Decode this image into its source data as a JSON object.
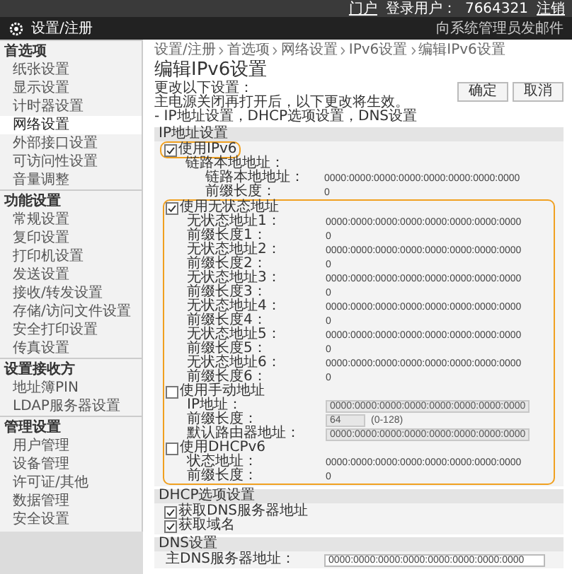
{
  "top_bar": {
    "portal": "门户",
    "login_label": "登录用户：",
    "user": "7664321",
    "logout": "注销"
  },
  "header": {
    "title": "设置/注册",
    "mail_link": "向系统管理员发邮件"
  },
  "sidebar": {
    "groups": [
      {
        "title": "首选项",
        "items": [
          {
            "label": "纸张设置",
            "selected": false
          },
          {
            "label": "显示设置",
            "selected": false
          },
          {
            "label": "计时器设置",
            "selected": false
          },
          {
            "label": "网络设置",
            "selected": true
          },
          {
            "label": "外部接口设置",
            "selected": false
          },
          {
            "label": "可访问性设置",
            "selected": false
          },
          {
            "label": "音量调整",
            "selected": false
          }
        ]
      },
      {
        "title": "功能设置",
        "items": [
          {
            "label": "常规设置",
            "selected": false
          },
          {
            "label": "复印设置",
            "selected": false
          },
          {
            "label": "打印机设置",
            "selected": false
          },
          {
            "label": "发送设置",
            "selected": false
          },
          {
            "label": "接收/转发设置",
            "selected": false
          },
          {
            "label": "存储/访问文件设置",
            "selected": false
          },
          {
            "label": "安全打印设置",
            "selected": false
          },
          {
            "label": "传真设置",
            "selected": false
          }
        ]
      },
      {
        "title": "设置接收方",
        "items": [
          {
            "label": "地址簿PIN",
            "selected": false
          },
          {
            "label": "LDAP服务器设置",
            "selected": false
          }
        ]
      },
      {
        "title": "管理设置",
        "items": [
          {
            "label": "用户管理",
            "selected": false
          },
          {
            "label": "设备管理",
            "selected": false
          },
          {
            "label": "许可证/其他",
            "selected": false
          },
          {
            "label": "数据管理",
            "selected": false
          },
          {
            "label": "安全设置",
            "selected": false
          }
        ]
      }
    ]
  },
  "breadcrumb": [
    "设置/注册",
    "首选项",
    "网络设置",
    "IPv6设置",
    "编辑IPv6设置"
  ],
  "title": "编辑IPv6设置",
  "notes": [
    "更改以下设置：",
    "主电源关闭再打开后，以下更改将生效。",
    "- IP地址设置，DHCP选项设置，DNS设置"
  ],
  "buttons": [
    "确定",
    "取消"
  ],
  "sections": [
    {
      "title": "IP地址设置",
      "items": [
        {
          "kind": "checkbox",
          "label": "使用IPv6",
          "checked": true,
          "highlighted": true,
          "children": [
            {
              "kind": "label",
              "label": "链路本地地址：",
              "children": [
                {
                  "kind": "value",
                  "label": "链路本地地址：",
                  "value": "0000:0000:0000:0000:0000:0000:0000:0000"
                },
                {
                  "kind": "value",
                  "label": "前缀长度：",
                  "value": "0"
                }
              ]
            }
          ]
        },
        {
          "kind": "frame",
          "children": [
            {
              "kind": "checkbox",
              "label": "使用无状态地址",
              "checked": true,
              "highlighted": false,
              "children": [
                {
                  "kind": "value",
                  "label": "无状态地址1：",
                  "value": "0000:0000:0000:0000:0000:0000:0000:0000"
                },
                {
                  "kind": "value",
                  "label": "前缀长度1：",
                  "value": "0"
                },
                {
                  "kind": "value",
                  "label": "无状态地址2：",
                  "value": "0000:0000:0000:0000:0000:0000:0000:0000"
                },
                {
                  "kind": "value",
                  "label": "前缀长度2：",
                  "value": "0"
                },
                {
                  "kind": "value",
                  "label": "无状态地址3：",
                  "value": "0000:0000:0000:0000:0000:0000:0000:0000"
                },
                {
                  "kind": "value",
                  "label": "前缀长度3：",
                  "value": "0"
                },
                {
                  "kind": "value",
                  "label": "无状态地址4：",
                  "value": "0000:0000:0000:0000:0000:0000:0000:0000"
                },
                {
                  "kind": "value",
                  "label": "前缀长度4：",
                  "value": "0"
                },
                {
                  "kind": "value",
                  "label": "无状态地址5：",
                  "value": "0000:0000:0000:0000:0000:0000:0000:0000"
                },
                {
                  "kind": "value",
                  "label": "前缀长度5：",
                  "value": "0"
                },
                {
                  "kind": "value",
                  "label": "无状态地址6：",
                  "value": "0000:0000:0000:0000:0000:0000:0000:0000"
                },
                {
                  "kind": "value",
                  "label": "前缀长度6：",
                  "value": "0"
                }
              ]
            },
            {
              "kind": "checkbox",
              "label": "使用手动地址",
              "checked": false,
              "highlighted": false,
              "children": [
                {
                  "kind": "field",
                  "label": "IP地址：",
                  "value": "0000:0000:0000:0000:0000:0000:0000:0000",
                  "disabled": true
                },
                {
                  "kind": "number-field",
                  "label": "前缀长度：",
                  "value": "64",
                  "hint": "(0-128)",
                  "disabled": true
                },
                {
                  "kind": "field",
                  "label": "默认路由器地址：",
                  "value": "0000:0000:0000:0000:0000:0000:0000:0000",
                  "disabled": true
                }
              ]
            },
            {
              "kind": "checkbox",
              "label": "使用DHCPv6",
              "checked": false,
              "highlighted": false,
              "children": [
                {
                  "kind": "value",
                  "label": "状态地址：",
                  "value": "0000:0000:0000:0000:0000:0000:0000:0000"
                },
                {
                  "kind": "value",
                  "label": "前缀长度：",
                  "value": "0"
                }
              ]
            }
          ]
        }
      ]
    },
    {
      "title": "DHCP选项设置",
      "items": [
        {
          "kind": "checkbox",
          "label": "获取DNS服务器地址",
          "checked": true,
          "highlighted": false
        },
        {
          "kind": "checkbox",
          "label": "获取域名",
          "checked": true,
          "highlighted": false
        }
      ]
    },
    {
      "title": "DNS设置",
      "items": [
        {
          "kind": "field",
          "label": "主DNS服务器地址：",
          "value": "0000:0000:0000:0000:0000:0000:0000:0000",
          "disabled": false
        }
      ]
    }
  ]
}
